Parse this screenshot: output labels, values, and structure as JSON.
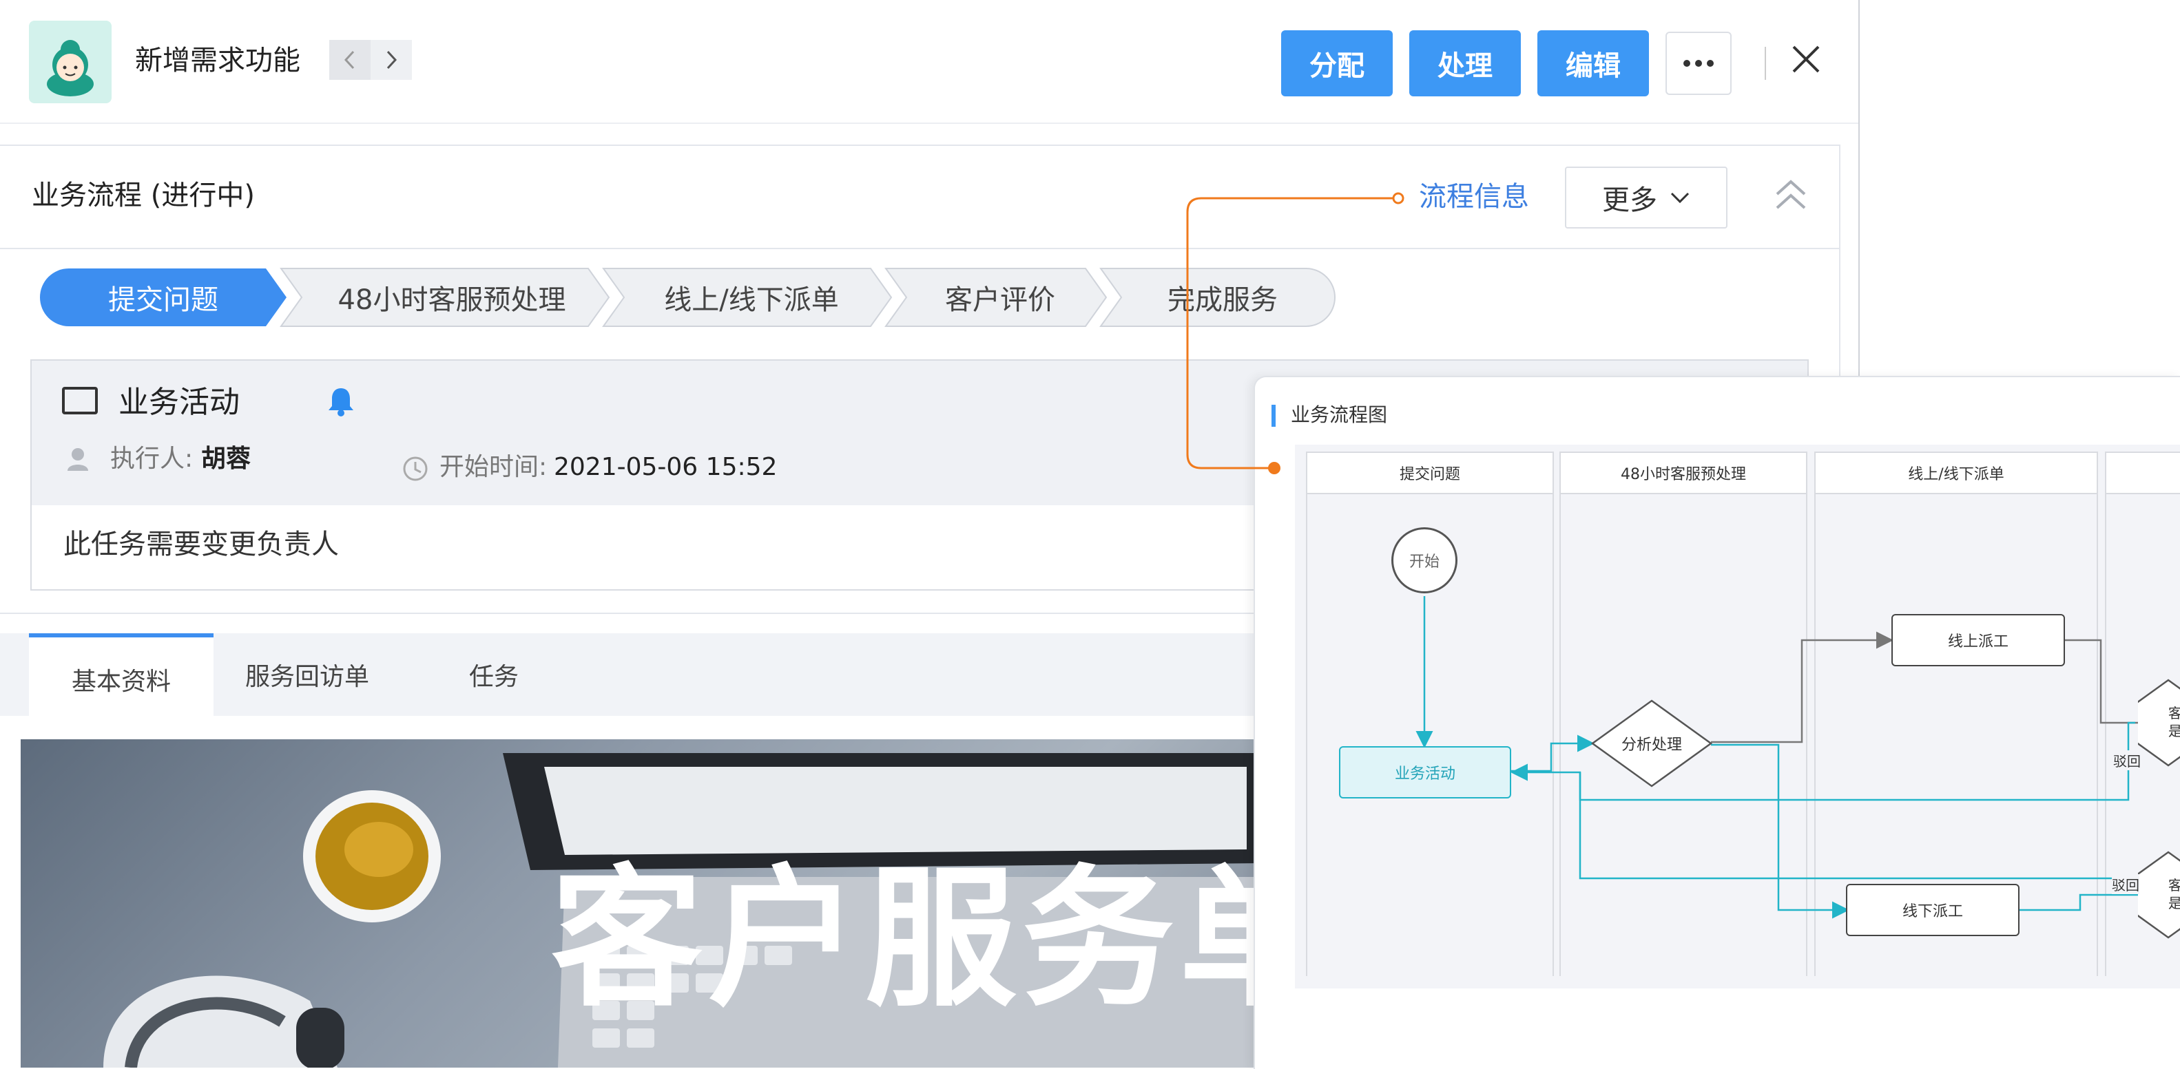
{
  "header": {
    "title": "新增需求功能",
    "buttons": {
      "assign": "分配",
      "process": "处理",
      "edit": "编辑"
    }
  },
  "process": {
    "title": "业务流程 (进行中)",
    "flow_info_link": "流程信息",
    "more_label": "更多",
    "steps": [
      "提交问题",
      "48小时客服预处理",
      "线上/线下派单",
      "客户评价",
      "完成服务"
    ]
  },
  "activity": {
    "title": "业务活动",
    "executor_label": "执行人:",
    "executor_name": "胡蓉",
    "start_label": "开始时间:",
    "start_time": "2021-05-06 15:52",
    "note": "此任务需要变更负责人"
  },
  "tabs": [
    "基本资料",
    "服务回访单",
    "任务"
  ],
  "banner": {
    "text": "客户服务单"
  },
  "diagram": {
    "title": "业务流程图",
    "lanes": [
      "提交问题",
      "48小时客服预处理",
      "线上/线下派单"
    ],
    "nodes": {
      "start": "开始",
      "activity": "业务活动",
      "analyze": "分析处理",
      "online": "线上派工",
      "offline": "线下派工",
      "reject1": "驳回",
      "reject2": "驳回",
      "cut1": "客",
      "cut1b": "是",
      "cut2": "客",
      "cut2b": "是"
    }
  },
  "colors": {
    "primary": "#3d98f5",
    "orange": "#f07a1c",
    "teal": "#22b4c8",
    "teal_fill": "#dff4f8"
  }
}
